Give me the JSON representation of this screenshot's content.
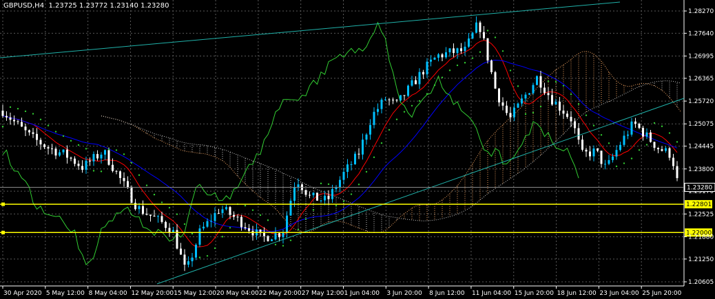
{
  "header": {
    "symbol": "GBPUSD,H4",
    "open": "1.23725",
    "high": "1.23772",
    "low": "1.23140",
    "close": "1.23280"
  },
  "price_axis": [
    "1.28270",
    "1.27640",
    "1.26995",
    "1.26365",
    "1.25720",
    "1.25075",
    "1.24445",
    "1.23800",
    "1.23170",
    "1.22525",
    "1.21880",
    "1.21250",
    "1.20605"
  ],
  "time_axis": [
    "30 Apr 2020",
    "5 May 12:00",
    "8 May 04:00",
    "12 May 20:00",
    "15 May 12:00",
    "20 May 04:00",
    "22 May 20:00",
    "27 May 12:00",
    "1 Jun 04:00",
    "3 Jun 20:00",
    "8 Jun 12:00",
    "11 Jun 04:00",
    "15 Jun 20:00",
    "18 Jun 12:00",
    "23 Jun 04:00",
    "25 Jun 20:00"
  ],
  "current_price": "1.23280",
  "levels": [
    {
      "price": "1.22801",
      "color": "#ffff00"
    },
    {
      "price": "1.22000",
      "color": "#ffff00"
    }
  ],
  "colors": {
    "background": "#000000",
    "candle_bull": "#00bfff",
    "candle_bear": "#ffffff",
    "tenkan": "#ff0000",
    "kijun": "#0000ff",
    "chikou": "#32cd32",
    "cloud_up": "#f4a460",
    "cloud_down": "#c8c8c8",
    "trendline": "#20b2aa",
    "parabolic_sar": "#32cd32",
    "level": "#ffff00"
  },
  "indicators": [
    "Ichimoku Kinko Hyo",
    "Parabolic SAR",
    "Trendlines",
    "Horizontal levels"
  ]
}
